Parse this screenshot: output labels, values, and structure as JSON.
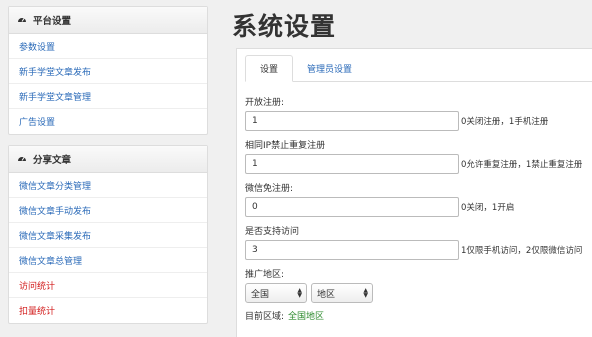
{
  "sidebar": {
    "platform": {
      "title": "平台设置",
      "items": [
        "参数设置",
        "新手学堂文章发布",
        "新手学堂文章管理",
        "广告设置"
      ]
    },
    "share": {
      "title": "分享文章",
      "items": [
        "微信文章分类管理",
        "微信文章手动发布",
        "微信文章采集发布",
        "微信文章总管理",
        "访问统计",
        "扣量统计"
      ]
    }
  },
  "page": {
    "title": "系统设置"
  },
  "tabs": [
    "设置",
    "管理员设置"
  ],
  "form": {
    "open_register": {
      "label": "开放注册:",
      "value": "1",
      "hint": "0关闭注册，1手机注册"
    },
    "same_ip": {
      "label": "相同IP禁止重复注册",
      "value": "1",
      "hint": "0允许重复注册，1禁止重复注册"
    },
    "wechat_free": {
      "label": "微信免注册:",
      "value": "0",
      "hint": "0关闭，1开启"
    },
    "support_access": {
      "label": "是否支持访问",
      "value": "3",
      "hint": "1仅限手机访问，2仅限微信访问"
    },
    "promo_region": {
      "label": "推广地区:",
      "country": "全国",
      "area": "地区"
    },
    "current_region": {
      "label": "目前区域:",
      "value": "全国地区"
    }
  },
  "colors": {
    "link": "#2a6ab8",
    "alert": "#d21a1a",
    "region": "#2e8b2e"
  }
}
